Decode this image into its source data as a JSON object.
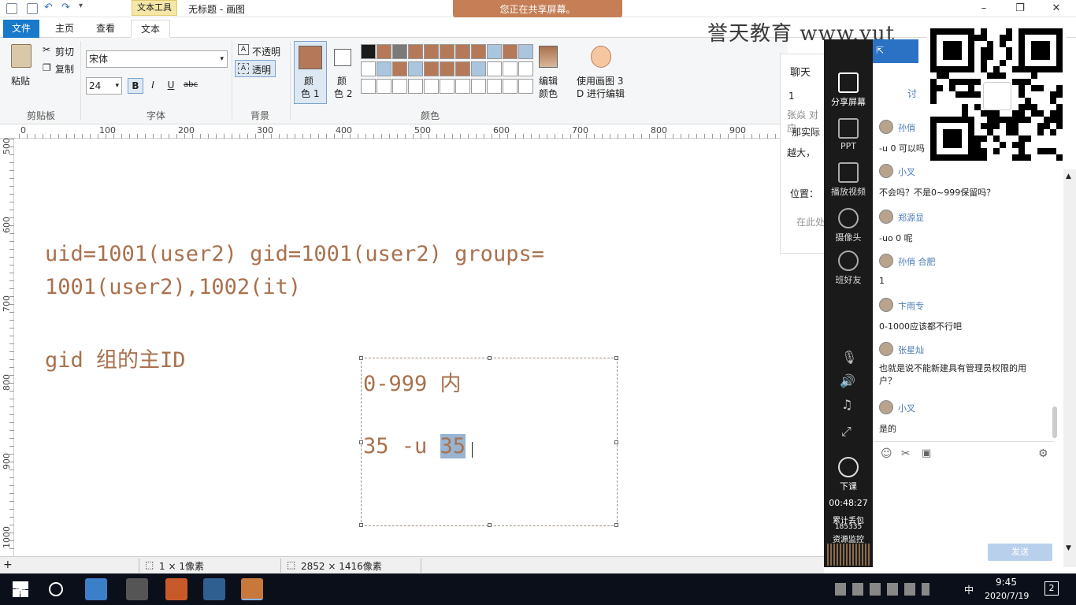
{
  "window": {
    "context_tab": "文本工具",
    "title": "无标题 - 画图",
    "share_banner": "您正在共享屏幕。"
  },
  "tabs": [
    "文件",
    "主页",
    "查看",
    "文本"
  ],
  "ribbon": {
    "clipboard": {
      "paste": "粘贴",
      "cut": "剪切",
      "copy": "复制",
      "label": "剪贴板"
    },
    "font": {
      "family": "宋体",
      "size": "24",
      "bold": "B",
      "italic": "I",
      "underline": "U",
      "strike": "abc",
      "label": "字体"
    },
    "background": {
      "opaque": "不透明",
      "transparent": "透明",
      "label": "背景"
    },
    "colors": {
      "color1_label_line1": "颜",
      "color1_label_line2": "色 1",
      "color2_label_line1": "颜",
      "color2_label_line2": "色 2",
      "color1": "#b5795a",
      "color2": "#ffffff",
      "edit_line1": "编辑",
      "edit_line2": "颜色",
      "paint3d_line1": "使用画图 3",
      "paint3d_line2": "D 进行编辑",
      "label": "颜色",
      "palette_row1": [
        "#1a1a1a",
        "#b5795a",
        "#7a7a7a",
        "#b5795a",
        "#b5795a",
        "#b5795a",
        "#b5795a",
        "#b5795a",
        "#aac5de",
        "#b5795a",
        "#aac5de"
      ],
      "palette_row2": [
        "#ffffff",
        "#aac5de",
        "#b5795a",
        "#aac5de",
        "#b5795a",
        "#b5795a",
        "#b5795a",
        "#aac5de",
        "#ffffff",
        "#ffffff",
        "#ffffff"
      ],
      "palette_row3": [
        "#ffffff",
        "#ffffff",
        "#ffffff",
        "#ffffff",
        "#ffffff",
        "#ffffff",
        "#ffffff",
        "#ffffff",
        "#ffffff",
        "#ffffff",
        "#ffffff"
      ]
    }
  },
  "ruler": {
    "h_labels": [
      "0",
      "100",
      "200",
      "300",
      "400",
      "500",
      "600",
      "700",
      "800",
      "900"
    ],
    "v_labels": [
      "500",
      "600",
      "700",
      "800",
      "900",
      "1000"
    ]
  },
  "canvas": {
    "line1": "uid=1001(user2) gid=1001(user2) groups=",
    "line2": "1001(user2),1002(it)",
    "line3": "gid 组的主ID",
    "box_line1": "0-999 内",
    "box_line2_prefix": "35 -u ",
    "box_line2_selected": "35"
  },
  "statusbar": {
    "selection": "1 × 1像素",
    "size": "2852 × 1416像素"
  },
  "watermark": "誉天教育 www.yut",
  "chat_bg": {
    "title": "聊天",
    "l1": "1",
    "l2": "张焱 对应",
    "l3": "那实际",
    "l4": "越大，",
    "l5": "位置：",
    "l6": "在此处"
  },
  "sidebar": {
    "items": [
      "分享屏幕",
      "PPT",
      "播放视频",
      "摄像头",
      "班好友",
      "下课"
    ],
    "timer": "00:48:27",
    "stat_label": "累计丢包",
    "stat_value": "185335",
    "monitor": "资源监控"
  },
  "chat": {
    "tab": "讨",
    "messages": [
      {
        "name": "孙俏",
        "text": "-u 0 可以吗"
      },
      {
        "name": "小叉",
        "text": "不会吗？不是0~999保留吗？"
      },
      {
        "name": "郑源显",
        "text": "-uo 0 呢"
      },
      {
        "name": "孙俏 合肥",
        "text": "1"
      },
      {
        "name": "卞雨专",
        "text": "0-1000应该都不行吧"
      },
      {
        "name": "张星灿",
        "text": "也就是说不能新建具有管理员权限的用户？"
      },
      {
        "name": "小叉",
        "text": "是的"
      }
    ],
    "send": "发送"
  },
  "taskbar": {
    "time": "9:45",
    "date": "2020/7/19",
    "lang": "中",
    "notif": "2"
  }
}
